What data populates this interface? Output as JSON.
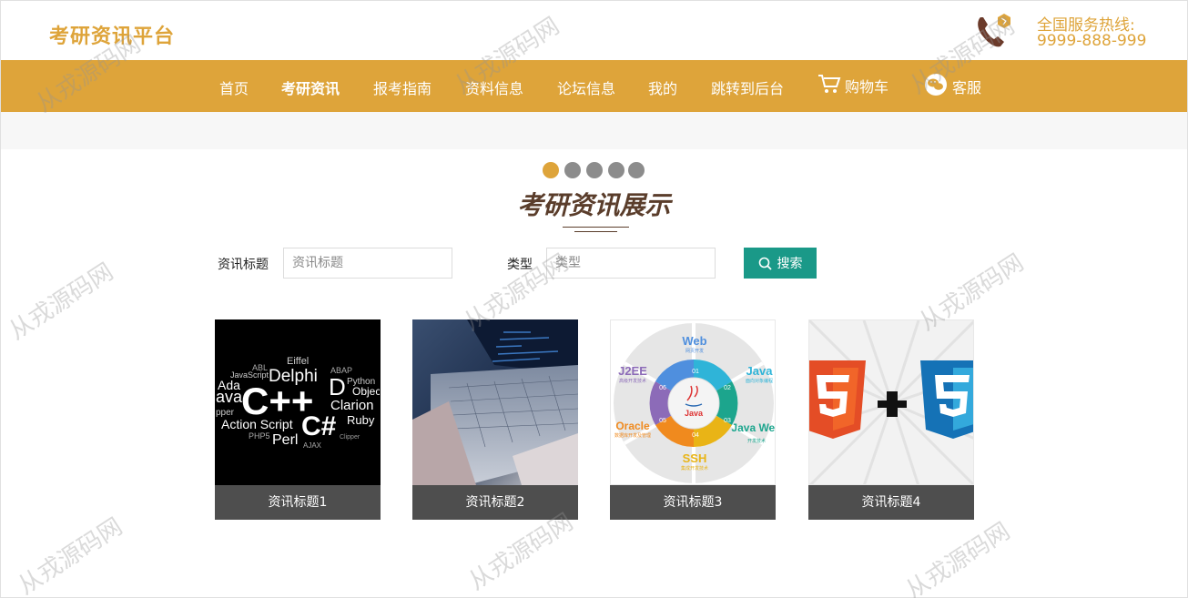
{
  "header": {
    "logo": "考研资讯平台",
    "hotline_label": "全国服务热线:",
    "hotline_number": "9999-888-999"
  },
  "nav": {
    "items": [
      {
        "label": "首页",
        "icon": null
      },
      {
        "label": "考研资讯",
        "icon": null,
        "active": true
      },
      {
        "label": "报考指南",
        "icon": null
      },
      {
        "label": "资料信息",
        "icon": null
      },
      {
        "label": "论坛信息",
        "icon": null
      },
      {
        "label": "我的",
        "icon": null
      },
      {
        "label": "跳转到后台",
        "icon": null
      },
      {
        "label": "购物车",
        "icon": "cart-icon"
      },
      {
        "label": "客服",
        "icon": "chat-icon"
      }
    ]
  },
  "carousel": {
    "dot_count": 5,
    "active_index": 0
  },
  "section": {
    "title": "考研资讯展示"
  },
  "search": {
    "title_label": "资讯标题",
    "title_placeholder": "资讯标题",
    "type_label": "类型",
    "type_placeholder": "类型",
    "button_label": "搜索"
  },
  "cards": [
    {
      "caption": "资讯标题1",
      "words": [
        "Eiffel",
        "ABL",
        "JavaScript",
        "Delphi",
        "ABAP",
        "Ada",
        "C++",
        "D",
        "Python",
        "Object",
        "ava",
        "Clarion",
        "C#",
        "Ruby",
        "pper",
        "Action Script",
        "PHP5",
        "Perl",
        "AJAX",
        "Clipper"
      ]
    },
    {
      "caption": "资讯标题2"
    },
    {
      "caption": "资讯标题3",
      "words": [
        "Web",
        "网页开发",
        "Java",
        "面向对象编程",
        "J2EE",
        "高级开发技术",
        "Java Web",
        "开发技术",
        "Oracle",
        "数据库开发及管理",
        "SSH",
        "集成开发技术",
        "01",
        "02",
        "03",
        "04",
        "05",
        "06",
        "Java"
      ]
    },
    {
      "caption": "资讯标题4"
    }
  ],
  "watermark": "从戎源码网",
  "colors": {
    "brand": "#dea43a",
    "search_button": "#1a9988",
    "caption_bg": "#4e4e4e",
    "title": "#5a3d2b"
  }
}
